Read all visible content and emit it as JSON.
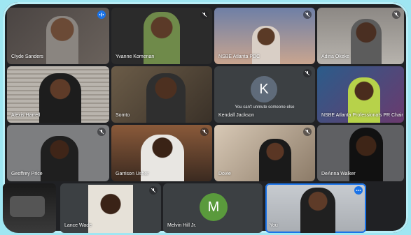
{
  "meeting": {
    "participants": [
      {
        "name": "Clyde Sanders",
        "state": "talking"
      },
      {
        "name": "Yvanne Komenan",
        "state": "muted"
      },
      {
        "name": "NSBE Atlanta PDC",
        "state": "muted"
      },
      {
        "name": "Adina Okeke",
        "state": "muted"
      },
      {
        "name": "Alexis Harrell",
        "state": "none"
      },
      {
        "name": "Somto",
        "state": "none"
      },
      {
        "name": "Kendall Jackson",
        "state": "muted",
        "avatar_letter": "K",
        "hint": "You can't unmute someone else"
      },
      {
        "name": "NSBE Atlanta Professionals PR Chair",
        "state": "none"
      },
      {
        "name": "Geoffrey Price",
        "state": "muted"
      },
      {
        "name": "Garrison Usher",
        "state": "muted"
      },
      {
        "name": "Dovie",
        "state": "muted"
      },
      {
        "name": "DeAnna Walker",
        "state": "none"
      },
      {
        "name": "",
        "state": "none"
      },
      {
        "name": "Lance Wade",
        "state": "muted"
      },
      {
        "name": "Melvin Hill Jr.",
        "state": "none",
        "avatar_letter": "M"
      },
      {
        "name": "You",
        "state": "more"
      }
    ]
  },
  "colors": {
    "tile_bg": "#3c4043",
    "kendall_avatar": "#5f6b7a",
    "melvin_avatar": "#5a9a3c",
    "speaking_blue": "#1a73e8",
    "window_outline": "#9fe6f2"
  }
}
